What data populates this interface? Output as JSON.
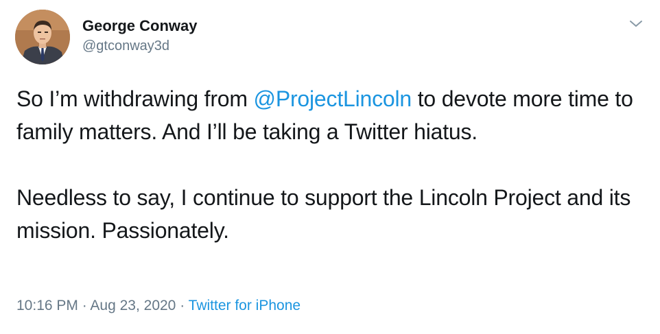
{
  "author": {
    "display_name": "George Conway",
    "handle": "@gtconway3d"
  },
  "tweet": {
    "para1_before": "So I’m withdrawing from ",
    "mention": "@ProjectLincoln",
    "para1_after": " to devote more time to family matters. And I’ll be taking a Twitter hiatus.",
    "para2": "Needless to say, I continue to support the Lincoln Project and its mission. Passionately."
  },
  "meta": {
    "time": "10:16 PM",
    "separator1": " · ",
    "date": "Aug 23, 2020",
    "separator2": " · ",
    "source": "Twitter for iPhone"
  },
  "icons": {
    "avatar": "avatar-portrait",
    "menu": "chevron-down-icon"
  },
  "colors": {
    "link": "#1b95e0",
    "secondary_text": "#657786",
    "primary_text": "#14171a"
  }
}
